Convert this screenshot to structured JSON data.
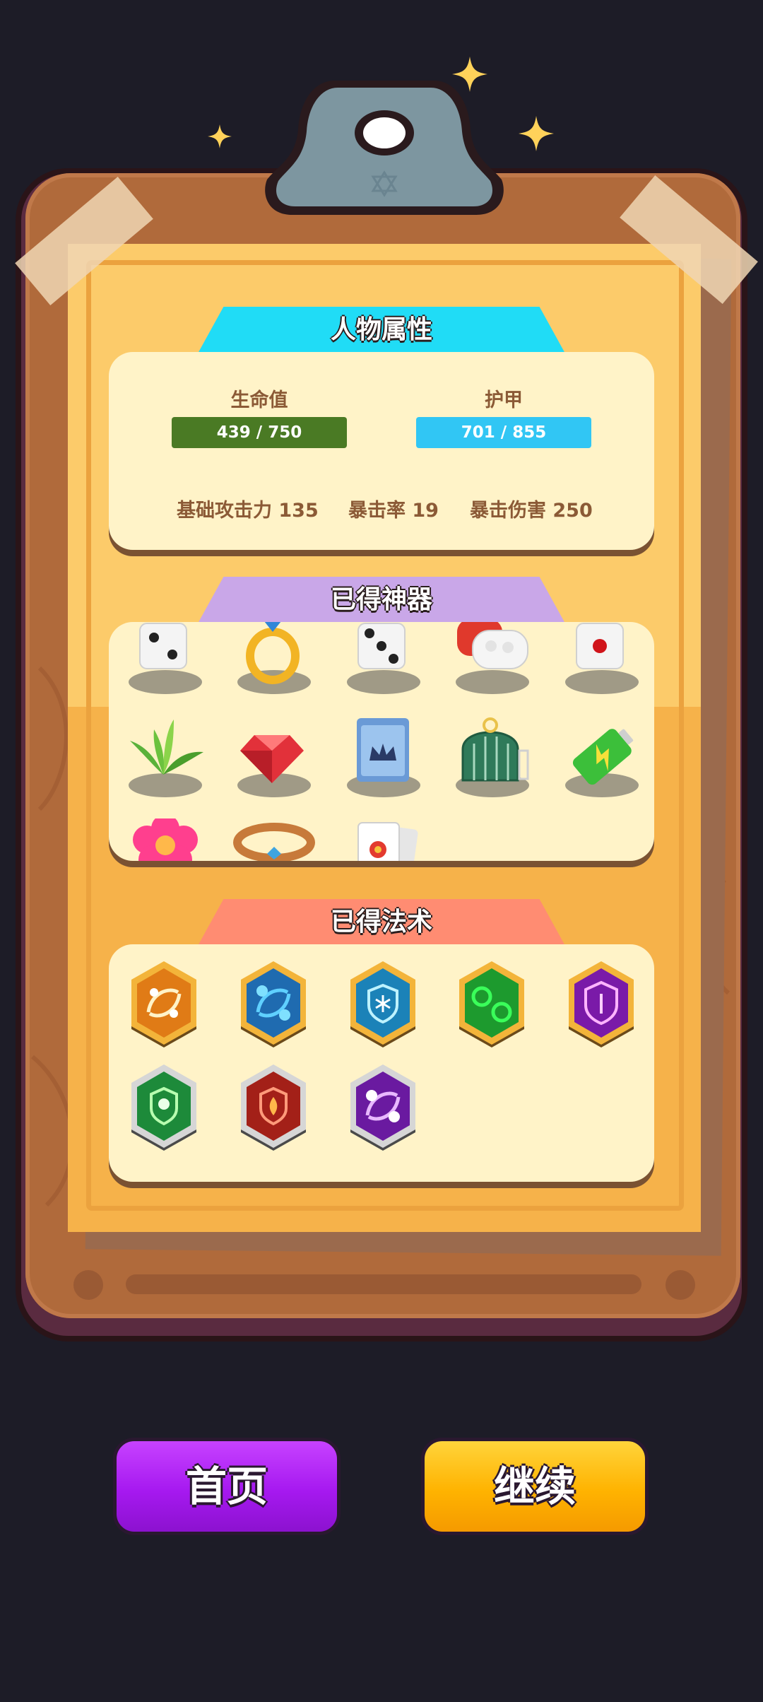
{
  "sections": {
    "attributes_title": "人物属性",
    "artifacts_title": "已得神器",
    "spells_title": "已得法术"
  },
  "stats": {
    "hp_label": "生命值",
    "hp_value": "439 / 750",
    "armor_label": "护甲",
    "armor_value": "701 / 855",
    "attack": "基础攻击力 135",
    "crit_rate": "暴击率 19",
    "crit_damage": "暴击伤害 250"
  },
  "buttons": {
    "home": "首页",
    "continue": "继续"
  },
  "colors": {
    "hp_bar": "#4a7a24",
    "armor_bar": "#31c6f4",
    "home_button": "#a619f0",
    "continue_button": "#ffb300",
    "attributes_tab": "#20dcf6",
    "artifacts_tab": "#c9a7e8",
    "spells_tab": "#ff8c72"
  },
  "artifacts": [
    "dice-2-icon",
    "gold-ring-icon",
    "dice-3-icon",
    "earbuds-case-icon",
    "dice-1-icon",
    "herb-leaves-icon",
    "red-gem-icon",
    "crown-bag-icon",
    "bird-cage-icon",
    "battery-icon",
    "pink-flower-icon",
    "copper-bracelet-icon",
    "joker-card-icon"
  ],
  "spells": [
    "orange-swirl-spell-icon",
    "blue-orbs-spell-icon",
    "ice-shield-spell-icon",
    "green-orbs-spell-icon",
    "purple-shield-spell-icon",
    "green-skull-shield-spell-icon",
    "red-flame-shield-spell-icon",
    "purple-orbs-spell-icon"
  ]
}
